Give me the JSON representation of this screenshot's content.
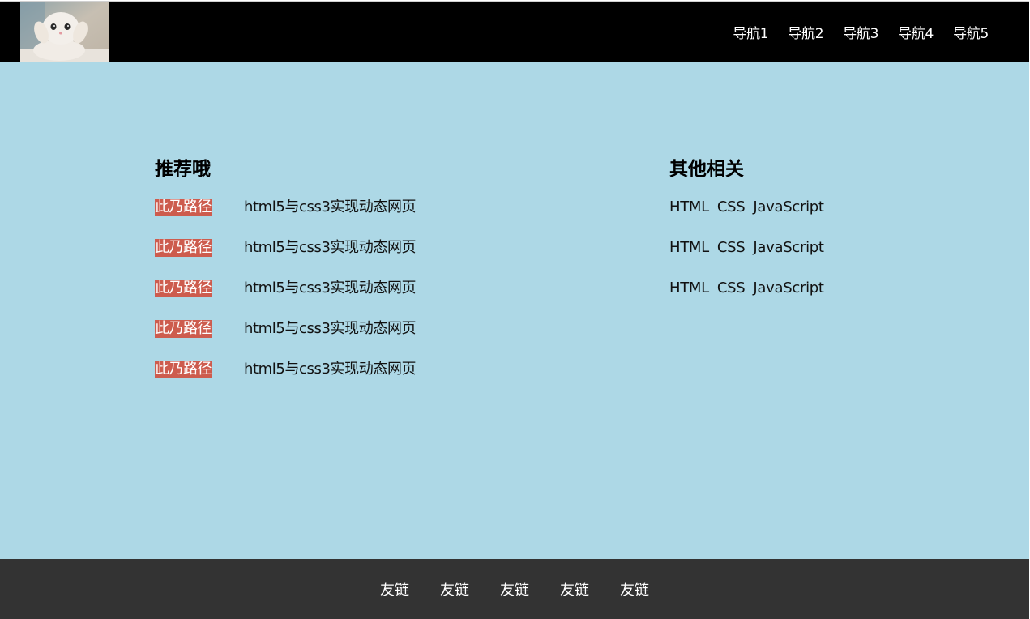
{
  "header": {
    "logo_alt": "cat",
    "nav": [
      "导航1",
      "导航2",
      "导航3",
      "导航4",
      "导航5"
    ]
  },
  "recommend": {
    "title": "推荐哦",
    "items": [
      {
        "tag": "此乃路径",
        "link": "html5与css3实现动态网页"
      },
      {
        "tag": "此乃路径",
        "link": "html5与css3实现动态网页"
      },
      {
        "tag": "此乃路径",
        "link": "html5与css3实现动态网页"
      },
      {
        "tag": "此乃路径",
        "link": "html5与css3实现动态网页"
      },
      {
        "tag": "此乃路径",
        "link": "html5与css3实现动态网页"
      }
    ]
  },
  "related": {
    "title": "其他相关",
    "rows": [
      [
        "HTML",
        "CSS",
        "JavaScript"
      ],
      [
        "HTML",
        "CSS",
        "JavaScript"
      ],
      [
        "HTML",
        "CSS",
        "JavaScript"
      ]
    ]
  },
  "footer": {
    "links": [
      "友链",
      "友链",
      "友链",
      "友链",
      "友链"
    ]
  },
  "colors": {
    "header_bg": "#000000",
    "main_bg": "#add8e6",
    "tag_bg": "#cd5c4e",
    "footer_bg": "#333333"
  }
}
